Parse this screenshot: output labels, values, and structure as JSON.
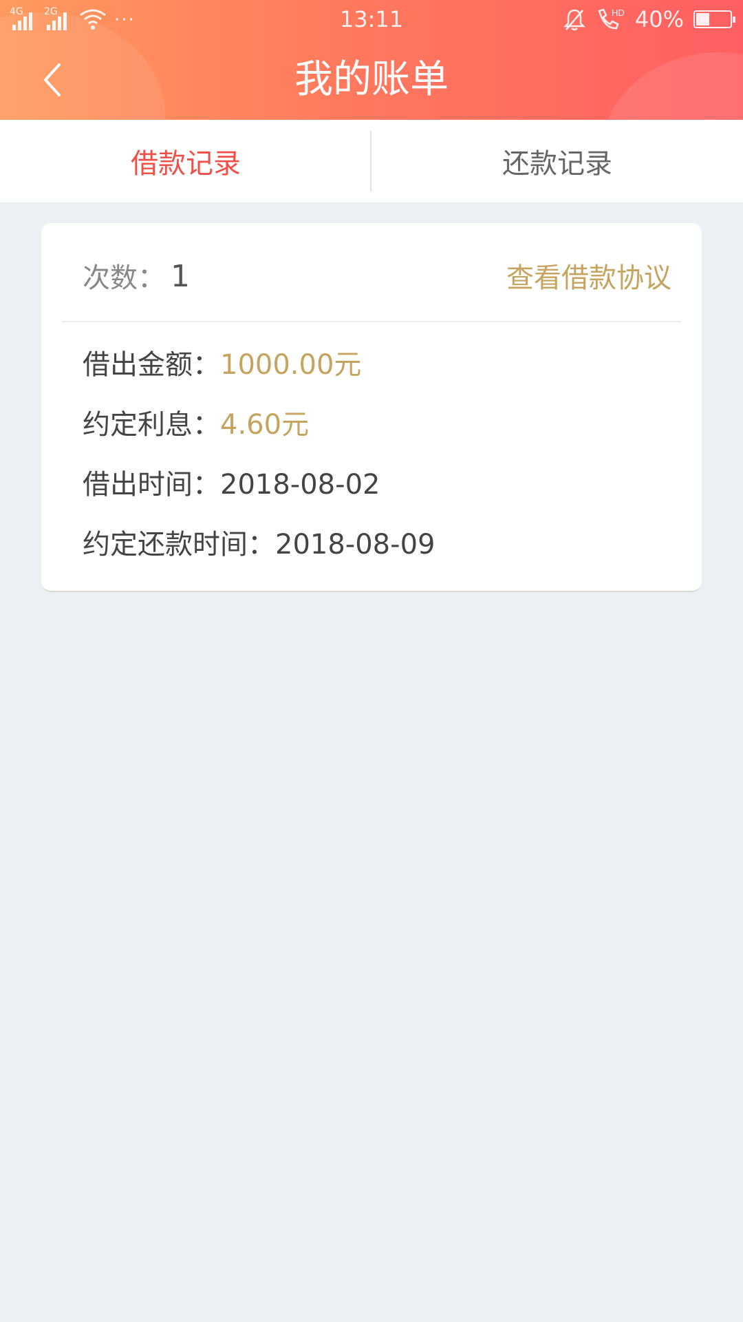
{
  "status_bar": {
    "sim1_tag": "4G",
    "sim2_tag": "2G",
    "more_dots": "···",
    "time": "13:11",
    "battery_percent": "40%",
    "battery_level": 0.4
  },
  "nav": {
    "title": "我的账单"
  },
  "tabs": [
    {
      "label": "借款记录",
      "active": true
    },
    {
      "label": "还款记录",
      "active": false
    }
  ],
  "colors": {
    "accent_red": "#f0504a",
    "gold": "#c4a45e",
    "header_gradient_start": "#ff9a5e",
    "header_gradient_end": "#ff5f62"
  },
  "record": {
    "count_label": "次数：",
    "count_value": "1",
    "agreement_link": "查看借款协议",
    "rows": [
      {
        "label": "借出金额：",
        "value": "1000.00元"
      },
      {
        "label": "约定利息：",
        "value": "4.60元"
      },
      {
        "label": "借出时间：",
        "value": "2018-08-02"
      },
      {
        "label": "约定还款时间：",
        "value": "2018-08-09"
      }
    ]
  }
}
